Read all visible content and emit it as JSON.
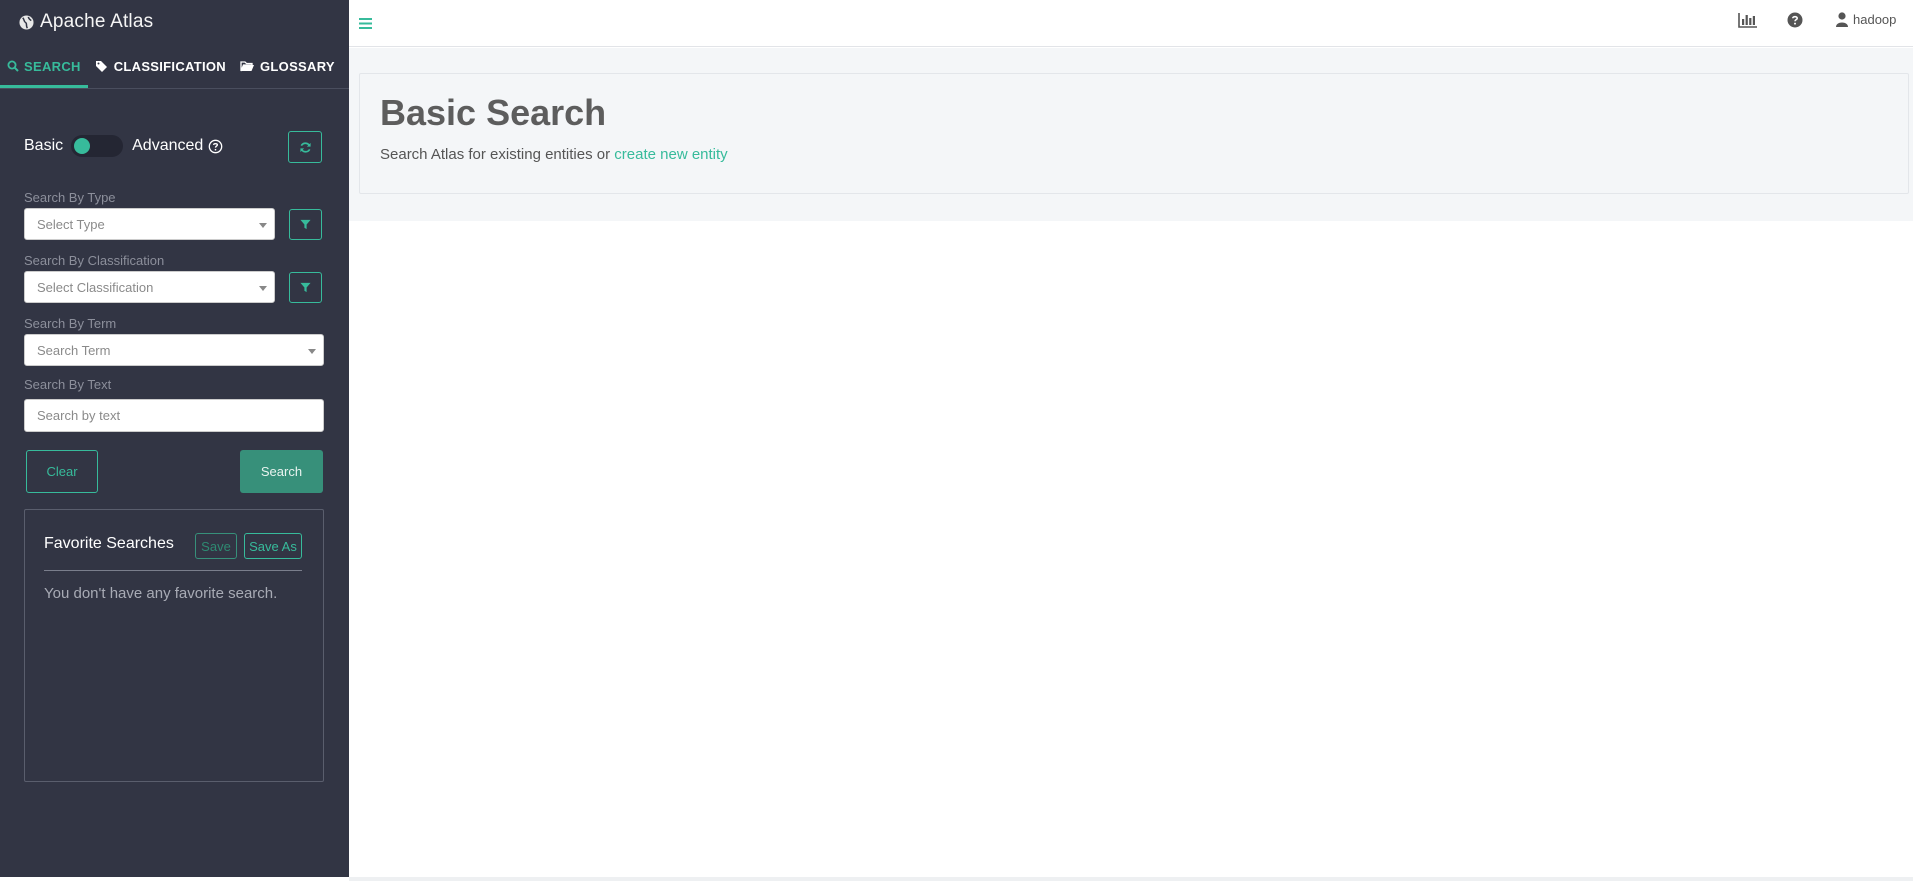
{
  "app": {
    "title": "Apache Atlas"
  },
  "tabs": [
    {
      "label": "SEARCH"
    },
    {
      "label": "CLASSIFICATION"
    },
    {
      "label": "GLOSSARY"
    }
  ],
  "search_mode": {
    "basic_label": "Basic",
    "advanced_label": "Advanced"
  },
  "filters": {
    "type": {
      "label": "Search By Type",
      "placeholder": "Select Type"
    },
    "classification": {
      "label": "Search By Classification",
      "placeholder": "Select Classification"
    },
    "term": {
      "label": "Search By Term",
      "placeholder": "Search Term"
    },
    "text": {
      "label": "Search By Text",
      "placeholder": "Search by text"
    }
  },
  "actions": {
    "clear_label": "Clear",
    "search_label": "Search"
  },
  "favorites": {
    "title": "Favorite Searches",
    "save_label": "Save",
    "save_as_label": "Save As",
    "empty_message": "You don't have any favorite search."
  },
  "header": {
    "user_name": "hadoop"
  },
  "main": {
    "heading": "Basic Search",
    "subtitle_prefix": "Search Atlas for existing entities or ",
    "create_link": "create new entity"
  },
  "colors": {
    "accent": "#37bb9b",
    "sidebar_bg": "#323544"
  }
}
